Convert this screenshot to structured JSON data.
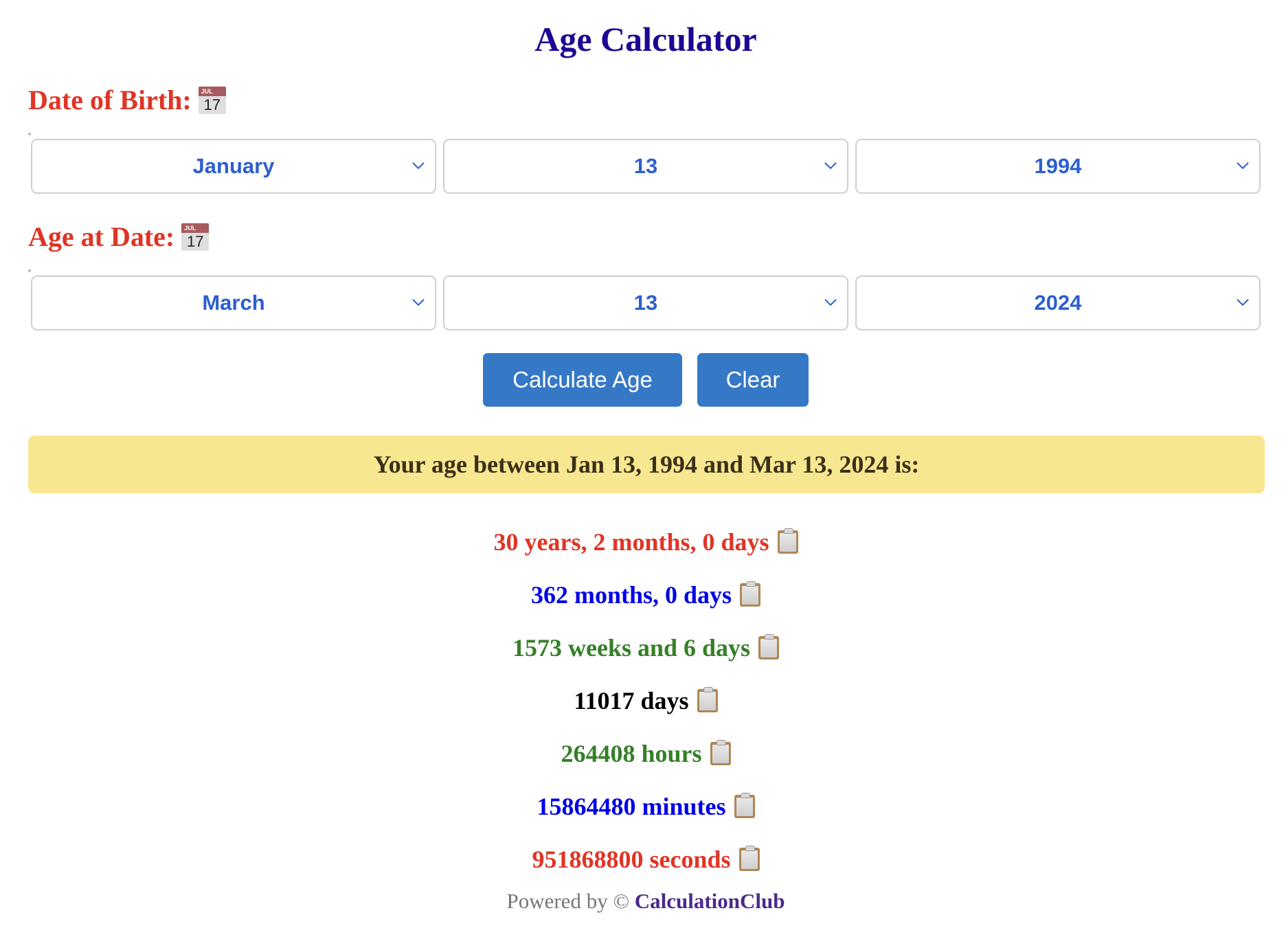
{
  "app": {
    "title": "Age Calculator"
  },
  "date_of_birth": {
    "label": "Date of Birth:",
    "icon": "calendar-icon",
    "icon_month": "JUL",
    "icon_day": "17",
    "month": "January",
    "day": "13",
    "year": "1994"
  },
  "age_at_date": {
    "label": "Age at Date:",
    "icon": "calendar-icon",
    "icon_month": "JUL",
    "icon_day": "17",
    "month": "March",
    "day": "13",
    "year": "2024"
  },
  "actions": {
    "calculate_label": "Calculate Age",
    "clear_label": "Clear"
  },
  "result": {
    "summary": "Your age between Jan 13, 1994 and Mar 13, 2024 is:",
    "items": [
      {
        "text": "30 years, 2 months, 0 days",
        "color": "#e03425"
      },
      {
        "text": "362 months, 0 days",
        "color": "#0000e6"
      },
      {
        "text": "1573 weeks and 6 days",
        "color": "#358028"
      },
      {
        "text": "11017 days",
        "color": "#000000"
      },
      {
        "text": "264408 hours",
        "color": "#358028"
      },
      {
        "text": "15864480 minutes",
        "color": "#0000e6"
      },
      {
        "text": "951868800 seconds",
        "color": "#e03425"
      }
    ],
    "copy_icon": "clipboard-icon"
  },
  "footer": {
    "prefix": "Powered by © ",
    "brand": "CalculationClub"
  },
  "colors": {
    "title": "#1d0793",
    "label": "#e03425",
    "select_text": "#2c5fcf",
    "button": "#3578c6",
    "result_box": "#f8e791",
    "brand": "#4a2a8a"
  }
}
